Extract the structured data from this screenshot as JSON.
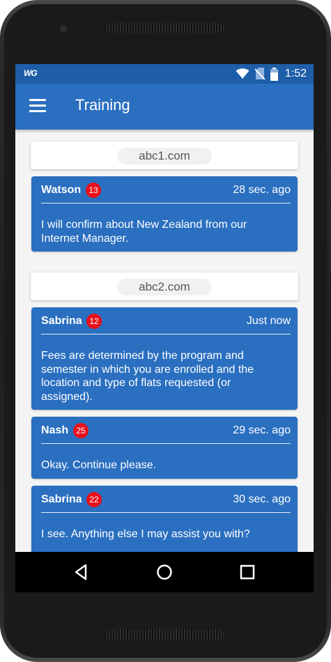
{
  "status_bar": {
    "carrier_logo": "WG",
    "icons": [
      "wifi-icon",
      "no-sim-icon",
      "battery-icon"
    ],
    "time": "1:52"
  },
  "app_bar": {
    "menu_icon": "hamburger-menu-icon",
    "title": "Training"
  },
  "groups": [
    {
      "domain": "abc1.com",
      "messages": [
        {
          "name": "Watson",
          "badge": "13",
          "time": "28 sec. ago",
          "text": "I will confirm about New Zealand from our Internet Manager."
        }
      ]
    },
    {
      "domain": "abc2.com",
      "messages": [
        {
          "name": "Sabrina",
          "badge": "12",
          "time": "Just now",
          "text": "Fees are determined by the program and semester in which you are enrolled and the location and type of flats requested (or assigned)."
        },
        {
          "name": "Nash",
          "badge": "25",
          "time": "29 sec. ago",
          "text": "Okay. Continue please."
        },
        {
          "name": "Sabrina",
          "badge": "22",
          "time": "30 sec. ago",
          "text": "I see. Anything else I may assist you with?"
        }
      ]
    }
  ],
  "nav_bar": {
    "icons": [
      "back-triangle-icon",
      "home-circle-icon",
      "recents-square-icon"
    ]
  },
  "colors": {
    "status_bar": "#1e5ea8",
    "app_bar": "#2a6fc0",
    "message_card": "#2a6fc0",
    "badge": "#e8101a",
    "background": "#f4f4f4"
  }
}
